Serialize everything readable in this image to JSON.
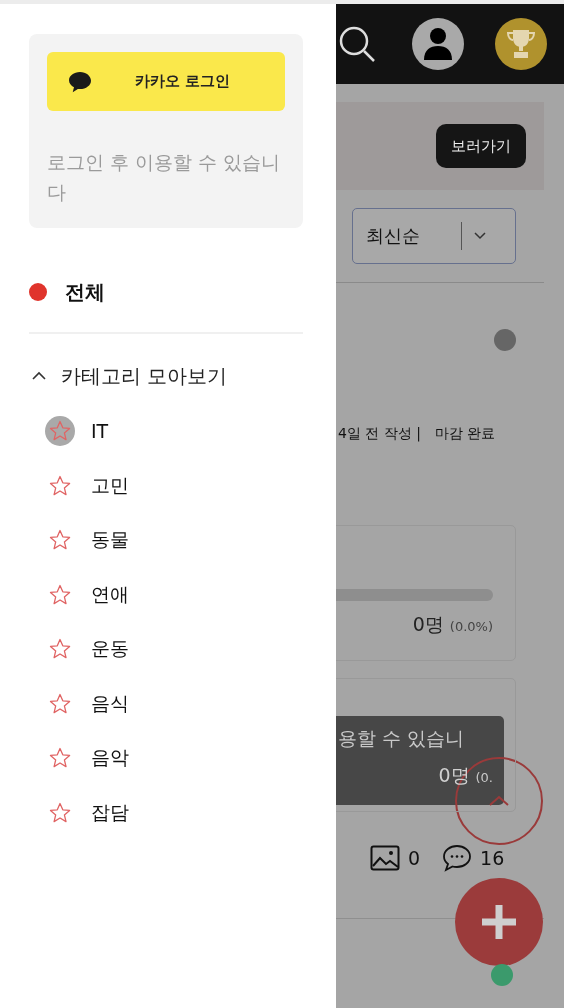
{
  "drawer": {
    "login_button": {
      "label": "카카오 로그인"
    },
    "login_hint": "로그인 후 이용할 수 있습니다",
    "all_item": {
      "label": "전체",
      "color": "#e0342c"
    },
    "category_header": {
      "label": "카테고리 모아보기",
      "expanded": true
    },
    "categories": [
      {
        "label": "IT",
        "selected": true
      },
      {
        "label": "고민",
        "selected": false
      },
      {
        "label": "동물",
        "selected": false
      },
      {
        "label": "연애",
        "selected": false
      },
      {
        "label": "운동",
        "selected": false
      },
      {
        "label": "음식",
        "selected": false
      },
      {
        "label": "음악",
        "selected": false
      },
      {
        "label": "잡담",
        "selected": false
      }
    ]
  },
  "page": {
    "banner_button": "보러가기",
    "sort": {
      "value": "최신순"
    },
    "post_meta": [
      "4일 전 작성 |",
      "마감 완료"
    ],
    "poll_cards": [
      {
        "count": "0명",
        "percent": "(0.0%)",
        "level": 0
      },
      {
        "count": "0명",
        "percent": "(0."
      }
    ],
    "toast": "용할 수 있습니",
    "stats": {
      "images": "0",
      "comments": "16"
    }
  }
}
